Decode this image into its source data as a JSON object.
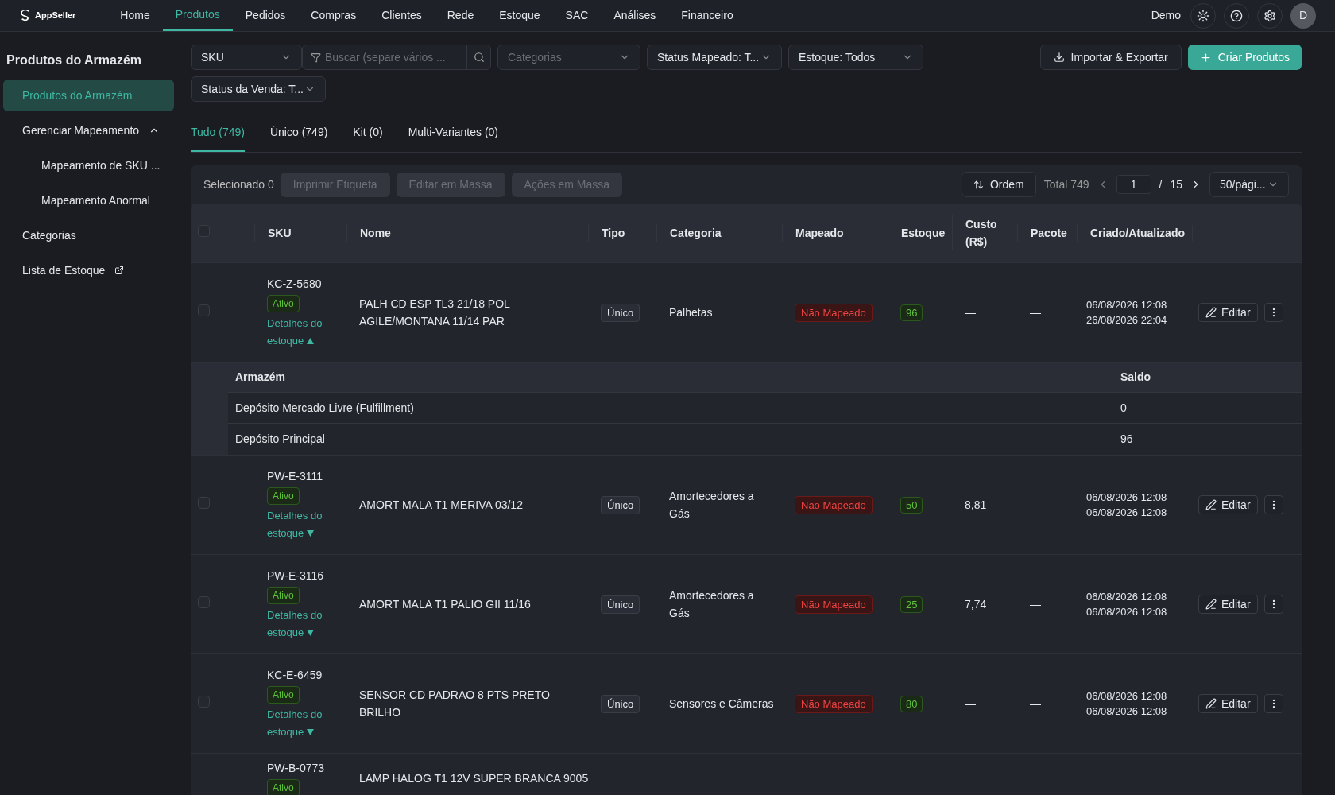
{
  "brand": {
    "name": "AppSeller"
  },
  "nav": [
    {
      "label": "Home",
      "selected": false
    },
    {
      "label": "Produtos",
      "selected": true
    },
    {
      "label": "Pedidos",
      "selected": false
    },
    {
      "label": "Compras",
      "selected": false
    },
    {
      "label": "Clientes",
      "selected": false
    },
    {
      "label": "Rede",
      "selected": false
    },
    {
      "label": "Estoque",
      "selected": false
    },
    {
      "label": "SAC",
      "selected": false
    },
    {
      "label": "Análises",
      "selected": false
    },
    {
      "label": "Financeiro",
      "selected": false
    }
  ],
  "user": {
    "name": "Demo",
    "avatar": "D"
  },
  "sidebar": {
    "title": "Produtos do Armazém",
    "items": [
      {
        "label": "Produtos do Armazém",
        "selected": true
      },
      {
        "label": "Gerenciar Mapeamento",
        "selected": false,
        "expanded": true,
        "children": [
          {
            "label": "Mapeamento de SKU ...",
            "selected": false
          },
          {
            "label": "Mapeamento Anormal",
            "selected": false
          }
        ]
      },
      {
        "label": "Categorias",
        "selected": false
      },
      {
        "label": "Lista de Estoque",
        "selected": false,
        "external": true
      }
    ]
  },
  "filters": {
    "field": "SKU",
    "search_placeholder": "Buscar (separe vários ...",
    "categories_placeholder": "Categorias",
    "mapped_status": "Status Mapeado: T...",
    "stock": "Estoque: Todos",
    "sale_status": "Status da Venda: T..."
  },
  "actions": {
    "import_export": "Importar & Exportar",
    "create": "Criar Produtos"
  },
  "tabs": [
    {
      "label": "Tudo (749)",
      "selected": true
    },
    {
      "label": "Único (749)",
      "selected": false
    },
    {
      "label": "Kit (0)",
      "selected": false
    },
    {
      "label": "Multi-Variantes (0)",
      "selected": false
    }
  ],
  "toolbar": {
    "selected": "Selecionado 0",
    "bulk": [
      {
        "label": "Imprimir Etiqueta",
        "disabled": true
      },
      {
        "label": "Editar em Massa",
        "disabled": true
      },
      {
        "label": "Ações em Massa",
        "disabled": true
      }
    ],
    "order": "Ordem",
    "total": "Total 749",
    "page": "1",
    "separator": "/",
    "pages": "15",
    "page_size": "50/pági..."
  },
  "table": {
    "header_checked": false,
    "columns": [
      "SKU",
      "Nome",
      "Tipo",
      "Categoria",
      "Mapeado",
      "Estoque",
      "Custo (R$)",
      "Pacote",
      "Criado/Atualizado"
    ],
    "rows": [
      {
        "checked": false,
        "sku": "KC-Z-5680",
        "status": "Ativo",
        "details": "Detalhes do estoque",
        "expanded": true,
        "name": "PALH CD ESP TL3 21/18 POL AGILE/MONTANA 11/14 PAR",
        "type": "Único",
        "category": "Palhetas",
        "mapped": "Não Mapeado",
        "stock": "96",
        "cost": "—",
        "package": "—",
        "created": "06/08/2026 12:08",
        "updated": "26/08/2026 22:04",
        "edit": "Editar",
        "warehouse_columns": [
          "Armazém",
          "Saldo"
        ],
        "warehouses": [
          {
            "name": "Depósito Mercado Livre (Fulfillment)",
            "balance": "0"
          },
          {
            "name": "Depósito Principal",
            "balance": "96"
          }
        ]
      },
      {
        "checked": false,
        "sku": "PW-E-3111",
        "status": "Ativo",
        "details": "Detalhes do estoque",
        "expanded": false,
        "name": "AMORT MALA T1 MERIVA 03/12",
        "type": "Único",
        "category": "Amortecedores a Gás",
        "mapped": "Não Mapeado",
        "stock": "50",
        "cost": "8,81",
        "package": "—",
        "created": "06/08/2026 12:08",
        "updated": "06/08/2026 12:08",
        "edit": "Editar"
      },
      {
        "checked": false,
        "sku": "PW-E-3116",
        "status": "Ativo",
        "details": "Detalhes do estoque",
        "expanded": false,
        "name": "AMORT MALA T1 PALIO GII 11/16",
        "type": "Único",
        "category": "Amortecedores a Gás",
        "mapped": "Não Mapeado",
        "stock": "25",
        "cost": "7,74",
        "package": "—",
        "created": "06/08/2026 12:08",
        "updated": "06/08/2026 12:08",
        "edit": "Editar"
      },
      {
        "checked": false,
        "sku": "KC-E-6459",
        "status": "Ativo",
        "details": "Detalhes do estoque",
        "expanded": false,
        "name": "SENSOR CD PADRAO 8 PTS PRETO BRILHO",
        "type": "Único",
        "category": "Sensores e Câmeras",
        "mapped": "Não Mapeado",
        "stock": "80",
        "cost": "—",
        "package": "—",
        "created": "06/08/2026 12:08",
        "updated": "06/08/2026 12:08",
        "edit": "Editar"
      },
      {
        "sku": "PW-B-0773",
        "status": "Ativo",
        "name": "LAMP HALOG T1 12V SUPER BRANCA 9005"
      }
    ]
  }
}
